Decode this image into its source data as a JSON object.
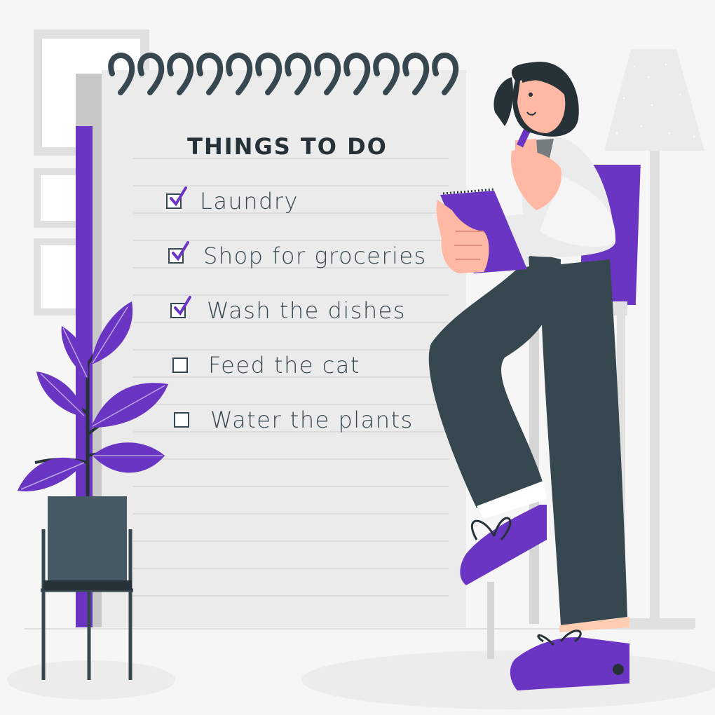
{
  "notepad": {
    "title": "THINGS TO DO",
    "items": [
      {
        "label": "Laundry",
        "checked": true
      },
      {
        "label": "Shop for groceries",
        "checked": true
      },
      {
        "label": "Wash the dishes",
        "checked": true
      },
      {
        "label": "Feed the cat",
        "checked": false
      },
      {
        "label": "Water the plants",
        "checked": false
      }
    ]
  },
  "colors": {
    "accent": "#6a35c2",
    "dark": "#37474f",
    "paper": "#ebebeb"
  }
}
